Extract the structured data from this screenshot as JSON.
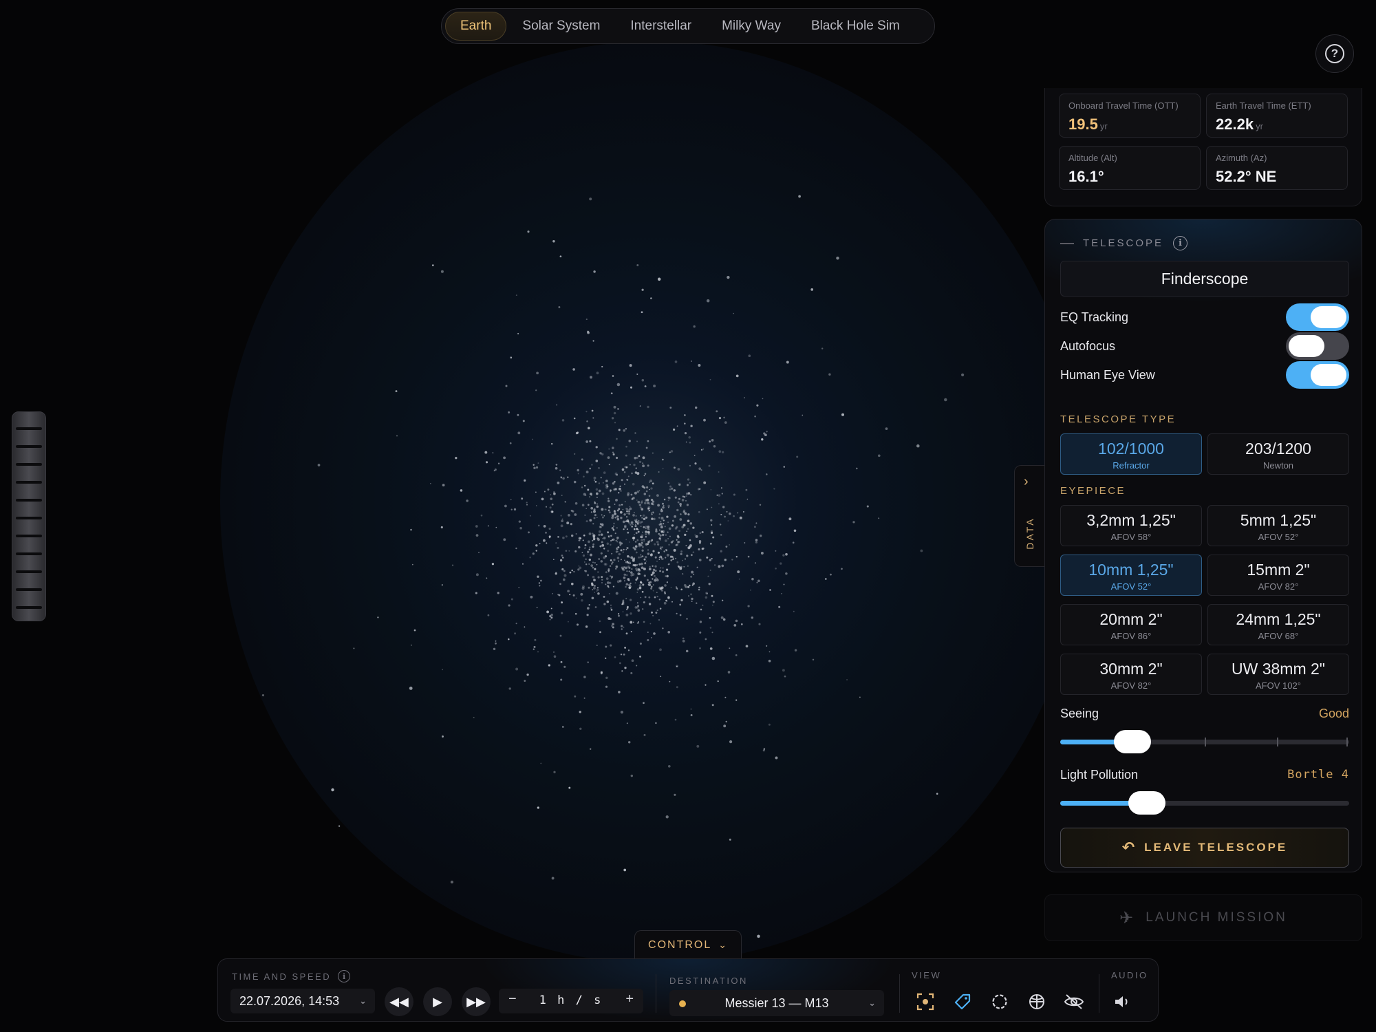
{
  "top_nav": {
    "tabs": [
      {
        "label": "Earth",
        "active": true
      },
      {
        "label": "Solar System",
        "active": false
      },
      {
        "label": "Interstellar",
        "active": false
      },
      {
        "label": "Milky Way",
        "active": false
      },
      {
        "label": "Black Hole Sim",
        "active": false
      }
    ],
    "help_icon": "question-circle-icon"
  },
  "stats": {
    "ott": {
      "label": "Onboard Travel Time (OTT)",
      "value": "19.5",
      "unit": "yr"
    },
    "ett": {
      "label": "Earth Travel Time (ETT)",
      "value": "22.2k",
      "unit": "yr"
    },
    "alt": {
      "label": "Altitude (Alt)",
      "value": "16.1°"
    },
    "az": {
      "label": "Azimuth (Az)",
      "value": "52.2° NE"
    }
  },
  "telescope": {
    "title": "TELESCOPE",
    "mode": "Finderscope",
    "toggles": [
      {
        "label": "EQ Tracking",
        "on": true
      },
      {
        "label": "Autofocus",
        "on": false
      },
      {
        "label": "Human Eye View",
        "on": true
      }
    ],
    "type_label": "TELESCOPE TYPE",
    "types": [
      {
        "main": "102/1000",
        "sub": "Refractor",
        "selected": true
      },
      {
        "main": "203/1200",
        "sub": "Newton",
        "selected": false
      }
    ],
    "eyepiece_label": "EYEPIECE",
    "eyepieces": [
      {
        "main": "3,2mm 1,25\"",
        "sub": "AFOV 58°",
        "selected": false
      },
      {
        "main": "5mm 1,25\"",
        "sub": "AFOV 52°",
        "selected": false
      },
      {
        "main": "10mm 1,25\"",
        "sub": "AFOV 52°",
        "selected": true
      },
      {
        "main": "15mm 2\"",
        "sub": "AFOV 82°",
        "selected": false
      },
      {
        "main": "20mm 2\"",
        "sub": "AFOV 86°",
        "selected": false
      },
      {
        "main": "24mm 1,25\"",
        "sub": "AFOV 68°",
        "selected": false
      },
      {
        "main": "30mm 2\"",
        "sub": "AFOV 82°",
        "selected": false
      },
      {
        "main": "UW 38mm 2\"",
        "sub": "AFOV 102°",
        "selected": false
      }
    ],
    "seeing": {
      "label": "Seeing",
      "value": "Good",
      "level": 0.25
    },
    "light_pollution": {
      "label": "Light Pollution",
      "value": "Bortle 4",
      "level": 0.3
    },
    "leave_label": "LEAVE TELESCOPE"
  },
  "launch_label": "LAUNCH MISSION",
  "data_tab_label": "DATA",
  "control": {
    "tab_label": "CONTROL",
    "time_label": "TIME AND SPEED",
    "datetime": "22.07.2026, 14:53",
    "speed": "1 h / s",
    "destination_label": "DESTINATION",
    "destination": "Messier 13 — M13",
    "view_label": "VIEW",
    "audio_label": "AUDIO",
    "view_icons": [
      "focus-target-icon",
      "tag-icon",
      "dashed-circle-icon",
      "globe-grid-icon",
      "eye-off-icon"
    ],
    "audio_icon": "speaker-icon"
  },
  "colors": {
    "accent_gold": "#f0c479",
    "accent_blue": "#4db0f5",
    "background": "#050506"
  }
}
